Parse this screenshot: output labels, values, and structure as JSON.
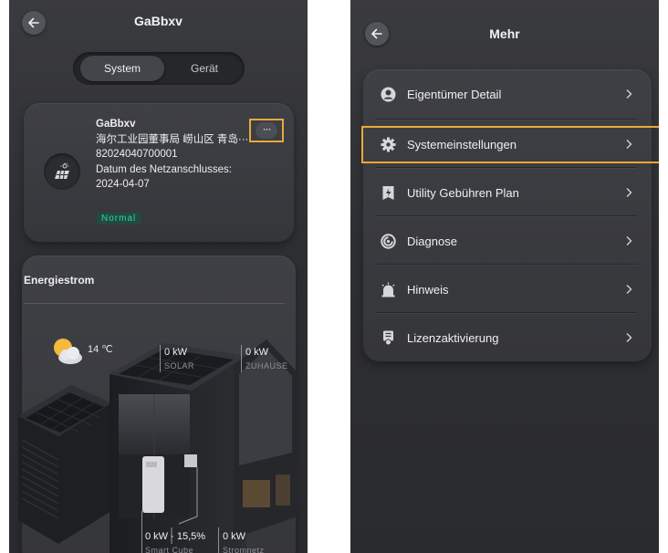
{
  "left": {
    "title": "GaBbxv",
    "tabs": {
      "system": "System",
      "device": "Gerät"
    },
    "plant": {
      "name": "GaBbxv",
      "address": "海尔工业园董事局 崂山区 青岛···",
      "id": "82024040700001",
      "date_label": "Datum des Netzanschlusses:",
      "date": "2024-04-07",
      "status": "Normal",
      "more_label": "···"
    },
    "energy": {
      "title": "Energiestrom",
      "temperature": "14 ℃",
      "solar_value": "0 kW",
      "solar_label": "SOLAR",
      "home_value": "0 kW",
      "home_label": "ZUHAUSE",
      "battery_value": "0 kW · 15,5%",
      "battery_label": "Smart Cube",
      "grid_value": "0 kW",
      "grid_label": "Stromnetz"
    }
  },
  "right": {
    "title": "Mehr",
    "menu": [
      {
        "label": "Eigentümer Detail",
        "icon": "user-circle-icon"
      },
      {
        "label": "Systemeinstellungen",
        "icon": "gear-icon"
      },
      {
        "label": "Utility Gebühren Plan",
        "icon": "bolt-tag-icon"
      },
      {
        "label": "Diagnose",
        "icon": "diagnose-icon"
      },
      {
        "label": "Hinweis",
        "icon": "alarm-icon"
      },
      {
        "label": "Lizenzaktivierung",
        "icon": "license-icon"
      }
    ]
  },
  "colors": {
    "highlight": "#e8a93a",
    "status_green": "#31d3a2",
    "background": "#2e2f33"
  }
}
